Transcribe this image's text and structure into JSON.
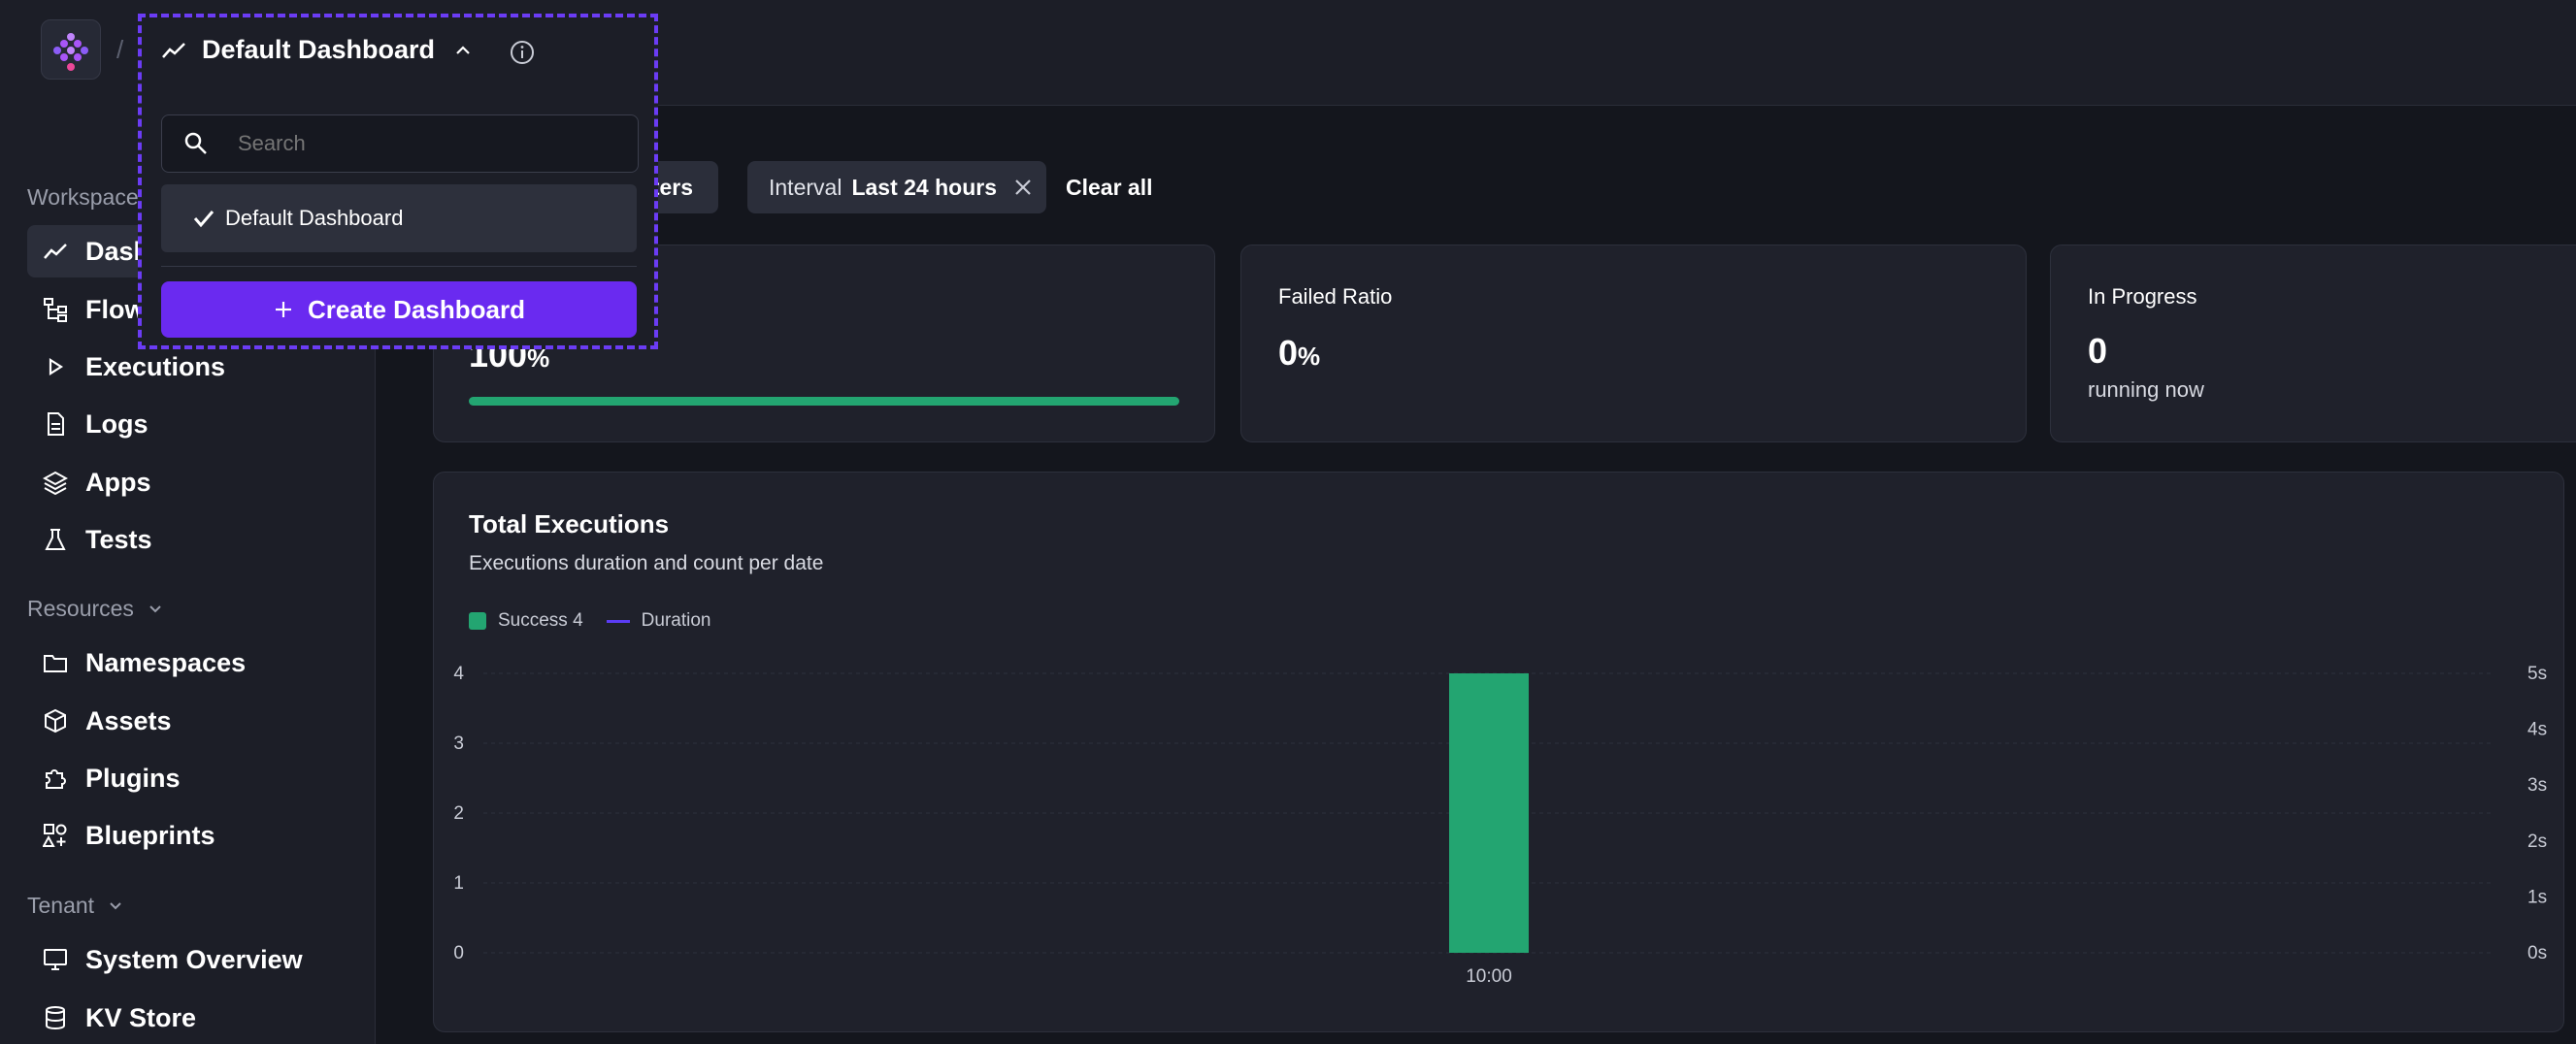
{
  "header": {
    "separator": "/",
    "dashboard_title": "Default Dashboard"
  },
  "dropdown": {
    "search_placeholder": "Search",
    "option_selected": "Default Dashboard",
    "create_label": "Create Dashboard"
  },
  "sidebar": {
    "workspace_label": "Workspace",
    "workspace_items": [
      {
        "label": "Dashboards",
        "icon": "chart-line-icon",
        "active": true
      },
      {
        "label": "Flows",
        "icon": "flow-icon"
      },
      {
        "label": "Executions",
        "icon": "play-icon"
      },
      {
        "label": "Logs",
        "icon": "file-icon"
      },
      {
        "label": "Apps",
        "icon": "layers-icon"
      },
      {
        "label": "Tests",
        "icon": "flask-icon"
      }
    ],
    "resources_label": "Resources",
    "resources_items": [
      {
        "label": "Namespaces",
        "icon": "folder-icon"
      },
      {
        "label": "Assets",
        "icon": "cube-icon"
      },
      {
        "label": "Plugins",
        "icon": "puzzle-icon"
      },
      {
        "label": "Blueprints",
        "icon": "shapes-icon"
      }
    ],
    "tenant_label": "Tenant",
    "tenant_items": [
      {
        "label": "System Overview",
        "icon": "monitor-icon"
      },
      {
        "label": "KV Store",
        "icon": "database-icon"
      }
    ]
  },
  "filters": {
    "filters_button": "Filters",
    "interval_prefix": "Interval",
    "interval_value": "Last 24 hours",
    "clear_all": "Clear all"
  },
  "kpis": {
    "success_value": "100",
    "success_unit": "%",
    "success_progress": 1.0,
    "failed_title": "Failed Ratio",
    "failed_value": "0",
    "failed_unit": "%",
    "inprogress_title": "In Progress",
    "inprogress_value": "0",
    "inprogress_sub": "running now"
  },
  "chart_card": {
    "title": "Total Executions",
    "subtitle": "Executions duration and count per date",
    "legend_success": "Success 4",
    "legend_duration": "Duration"
  },
  "colors": {
    "accent": "#6a2af0",
    "success": "#23a571",
    "duration_line": "#5b3cf5"
  },
  "chart_data": {
    "type": "bar",
    "categories": [
      "10:00"
    ],
    "series": [
      {
        "name": "Success",
        "values": [
          4
        ]
      },
      {
        "name": "Duration",
        "values": [
          0
        ]
      }
    ],
    "xlabel": "",
    "ylabel": "",
    "ylim": [
      0,
      4
    ],
    "y_ticks": [
      "0",
      "1",
      "2",
      "3",
      "4"
    ],
    "y2_ticks": [
      "0s",
      "1s",
      "2s",
      "3s",
      "4s",
      "5s"
    ],
    "y2lim": [
      0,
      5
    ],
    "grid": true,
    "legend": "top-left"
  }
}
